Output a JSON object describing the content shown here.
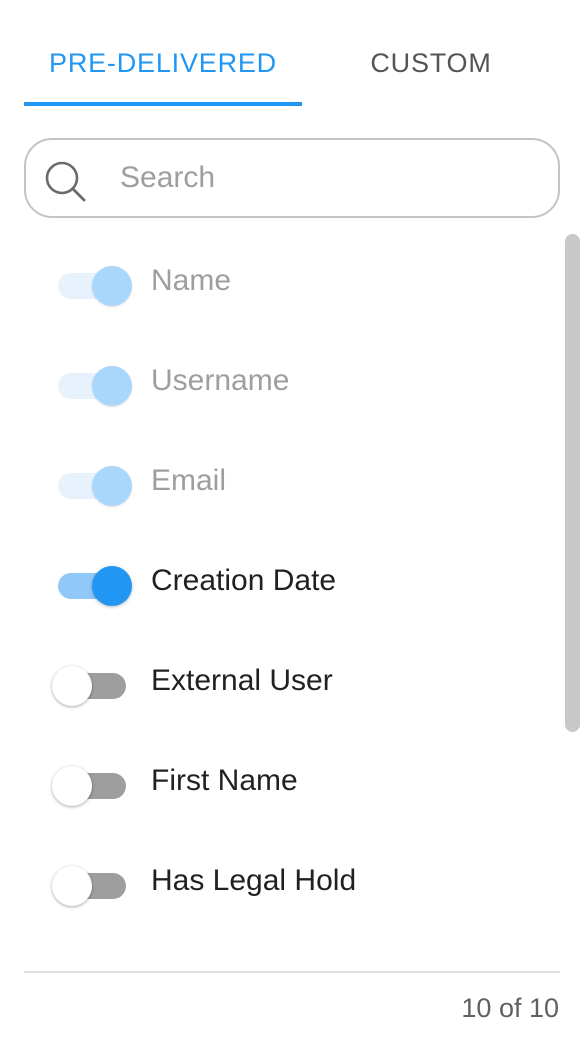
{
  "tabs": [
    {
      "label": "PRE-DELIVERED",
      "active": true
    },
    {
      "label": "CUSTOM",
      "active": false
    }
  ],
  "search": {
    "placeholder": "Search",
    "value": ""
  },
  "columns": [
    {
      "label": "Name",
      "checked": true,
      "disabled": true
    },
    {
      "label": "Username",
      "checked": true,
      "disabled": true
    },
    {
      "label": "Email",
      "checked": true,
      "disabled": true
    },
    {
      "label": "Creation Date",
      "checked": true,
      "disabled": false
    },
    {
      "label": "External User",
      "checked": false,
      "disabled": false
    },
    {
      "label": "First Name",
      "checked": false,
      "disabled": false
    },
    {
      "label": "Has Legal Hold",
      "checked": false,
      "disabled": false
    }
  ],
  "footer": {
    "count_text": "10 of 10"
  },
  "colors": {
    "accent": "#2196f3",
    "accent_light": "#90c8f8",
    "disabled_thumb": "#a9d6fb",
    "disabled_track": "#e7f2fd",
    "off_track": "#9e9e9e",
    "border": "#c4c4c4"
  },
  "icons": {
    "search": "search-icon"
  }
}
